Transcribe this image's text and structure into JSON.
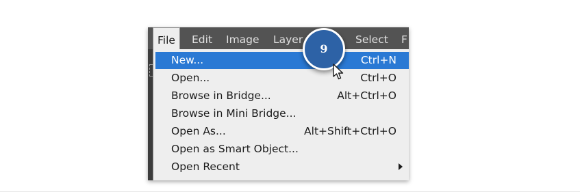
{
  "menubar": {
    "items": [
      {
        "label": "File",
        "active": true
      },
      {
        "label": "Edit"
      },
      {
        "label": "Image"
      },
      {
        "label": "Layer"
      },
      {
        "label": "Select"
      },
      {
        "label": "F"
      }
    ]
  },
  "file_menu": {
    "items": [
      {
        "label": "New...",
        "shortcut": "Ctrl+N",
        "highlighted": true
      },
      {
        "label": "Open...",
        "shortcut": "Ctrl+O"
      },
      {
        "label": "Browse in Bridge...",
        "shortcut": "Alt+Ctrl+O"
      },
      {
        "label": "Browse in Mini Bridge...",
        "shortcut": ""
      },
      {
        "label": "Open As...",
        "shortcut": "Alt+Shift+Ctrl+O"
      },
      {
        "label": "Open as Smart Object...",
        "shortcut": ""
      },
      {
        "label": "Open Recent",
        "shortcut": "",
        "submenu": true
      }
    ]
  },
  "step_badge": {
    "number": "9"
  },
  "colors": {
    "menubar_bg": "#535353",
    "menu_bg": "#eeeeee",
    "highlight": "#2a79d4",
    "badge": "#2d62a6"
  },
  "icons": {
    "cursor": "arrow-cursor-icon",
    "submenu": "submenu-arrow-icon"
  }
}
